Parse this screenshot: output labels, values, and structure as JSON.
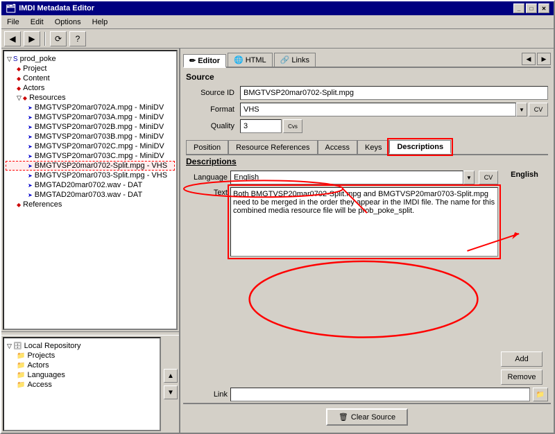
{
  "window": {
    "title": "IMDI Metadata Editor",
    "min_btn": "_",
    "max_btn": "□",
    "close_btn": "✕"
  },
  "menu": {
    "items": [
      "File",
      "Edit",
      "Options",
      "Help"
    ]
  },
  "toolbar": {
    "buttons": [
      "◀",
      "▶",
      "⟳",
      "?"
    ]
  },
  "tabs": {
    "top": [
      {
        "label": "Editor",
        "icon": "✏️",
        "active": true
      },
      {
        "label": "HTML",
        "icon": "🌐",
        "active": false
      },
      {
        "label": "Links",
        "icon": "🔗",
        "active": false
      }
    ],
    "extra_btns": [
      "◀",
      "▶"
    ]
  },
  "source_section": {
    "title": "Source",
    "source_id_label": "Source ID",
    "source_id_value": "BMGTVSP20mar0702-Split.mpg",
    "format_label": "Format",
    "format_value": "VHS",
    "quality_label": "Quality",
    "quality_value": "3"
  },
  "inner_tabs": {
    "items": [
      "Position",
      "Resource References",
      "Access",
      "Keys",
      "Descriptions"
    ]
  },
  "descriptions": {
    "title": "Descriptions",
    "language_label": "Language",
    "language_value": "English",
    "text_label": "Text",
    "text_value": "Both BMGTVSP20mar0702-Split.mpg and BMGTVSP20mar0703-Split.mpg need to be merged in the order they appear in the IMDI file. The name for this combined media resource file will be prob_poke_split.",
    "right_label": "English",
    "add_btn": "Add",
    "remove_btn": "Remove",
    "link_label": "Link",
    "link_value": ""
  },
  "bottom_bar": {
    "clear_source_label": "Clear Source",
    "clear_source_icon": "🗑"
  },
  "left_tree": {
    "items": [
      {
        "label": "prod_poke",
        "indent": 0,
        "icon": "folder",
        "expand": true
      },
      {
        "label": "Project",
        "indent": 1,
        "icon": "diamond"
      },
      {
        "label": "Content",
        "indent": 1,
        "icon": "diamond"
      },
      {
        "label": "Actors",
        "indent": 1,
        "icon": "diamond"
      },
      {
        "label": "Resources",
        "indent": 1,
        "icon": "folder",
        "expand": true
      },
      {
        "label": "BMGTVSP20mar0702A.mpg - MiniDV",
        "indent": 2,
        "icon": "arrow"
      },
      {
        "label": "BMGTVSP20mar0703A.mpg - MiniDV",
        "indent": 2,
        "icon": "arrow"
      },
      {
        "label": "BMGTVSP20mar0702B.mpg - MiniDV",
        "indent": 2,
        "icon": "arrow"
      },
      {
        "label": "BMGTVSP20mar0703B.mpg - MiniDV",
        "indent": 2,
        "icon": "arrow"
      },
      {
        "label": "BMGTVSP20mar0702C.mpg - MiniDV",
        "indent": 2,
        "icon": "arrow"
      },
      {
        "label": "BMGTVSP20mar0703C.mpg - MiniDV",
        "indent": 2,
        "icon": "arrow"
      },
      {
        "label": "BMGTVSP20mar0702-Split.mpg - VHS",
        "indent": 2,
        "icon": "arrow",
        "selected": true
      },
      {
        "label": "BMGTVSP20mar0703-Split.mpg - VHS",
        "indent": 2,
        "icon": "arrow"
      },
      {
        "label": "BMGTAD20mar0702.wav - DAT",
        "indent": 2,
        "icon": "arrow"
      },
      {
        "label": "BMGTAD20mar0703.wav - DAT",
        "indent": 2,
        "icon": "arrow"
      },
      {
        "label": "References",
        "indent": 1,
        "icon": "diamond"
      }
    ]
  },
  "bottom_tree": {
    "items": [
      {
        "label": "Local Repository",
        "indent": 0,
        "icon": "db",
        "expand": true
      },
      {
        "label": "Projects",
        "indent": 1,
        "icon": "folder"
      },
      {
        "label": "Actors",
        "indent": 1,
        "icon": "folder"
      },
      {
        "label": "Languages",
        "indent": 1,
        "icon": "folder"
      },
      {
        "label": "Access",
        "indent": 1,
        "icon": "folder"
      }
    ]
  }
}
